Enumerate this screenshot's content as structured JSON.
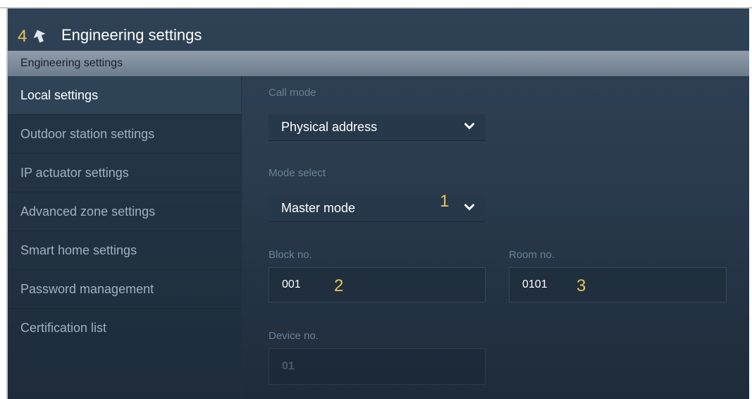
{
  "annotations": {
    "back": "4",
    "mode": "1",
    "block": "2",
    "room": "3"
  },
  "header": {
    "title": "Engineering settings",
    "back_icon": "arrow-up-back-icon"
  },
  "subheader": {
    "title": "Engineering settings"
  },
  "sidebar": {
    "items": [
      {
        "label": "Local settings",
        "active": true
      },
      {
        "label": "Outdoor station settings"
      },
      {
        "label": "IP actuator settings"
      },
      {
        "label": "Advanced zone settings"
      },
      {
        "label": "Smart home settings"
      },
      {
        "label": "Password management"
      },
      {
        "label": "Certification list"
      }
    ]
  },
  "form": {
    "call_mode": {
      "label": "Call mode",
      "value": "Physical address"
    },
    "mode_select": {
      "label": "Mode select",
      "value": "Master mode"
    },
    "block_no": {
      "label": "Block no.",
      "value": "001"
    },
    "room_no": {
      "label": "Room no.",
      "value": "0101"
    },
    "device_no": {
      "label": "Device no.",
      "value": "01"
    }
  },
  "colors": {
    "accent_annotation": "#e8c35a",
    "background": "#2a3b4d",
    "label": "#6b8196"
  }
}
